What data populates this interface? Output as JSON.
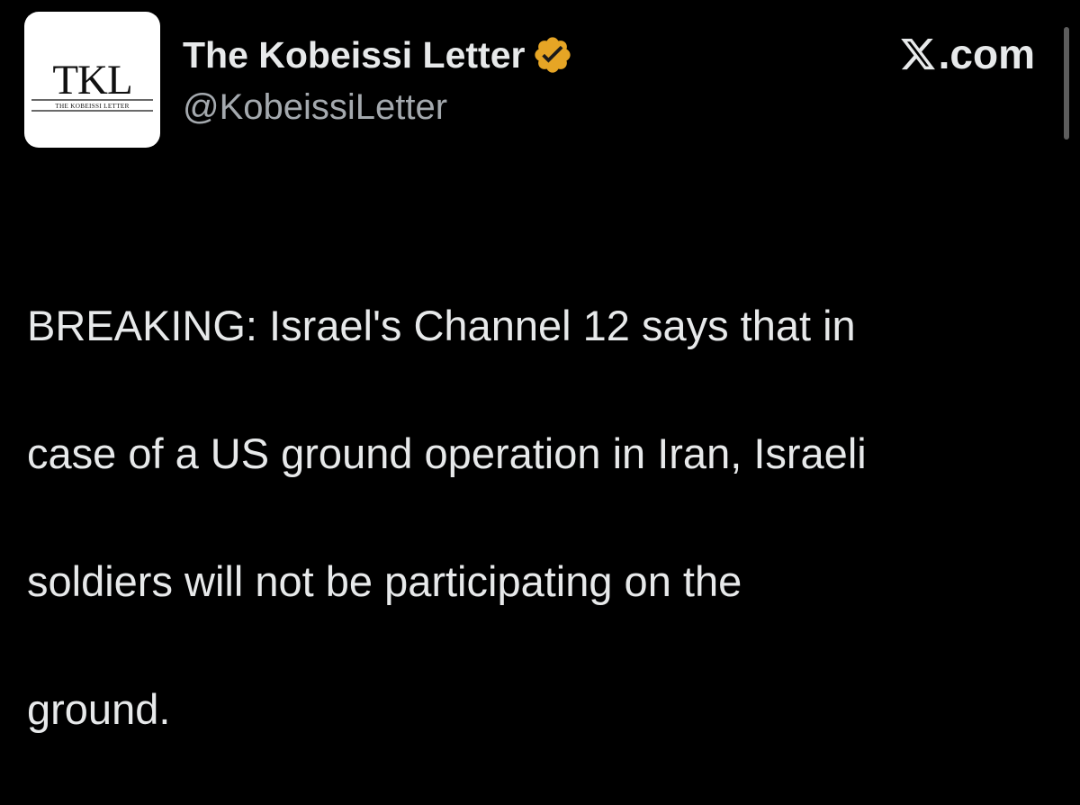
{
  "post": {
    "author": {
      "display_name": "The Kobeissi Letter",
      "handle": "@KobeissiLetter",
      "avatar": {
        "monogram": "TKL",
        "wordmark": "THE KOBEISSI LETTER"
      },
      "verified": true,
      "verified_badge_color": "#e6a525"
    },
    "source": {
      "label": ".com",
      "icon": "x-logo-icon"
    },
    "text_lines": [
      "BREAKING: Israel's Channel 12 says that in",
      "case of a US ground operation in Iran, Israeli",
      "soldiers will not be participating on the",
      "ground."
    ]
  },
  "colors": {
    "background": "#000000",
    "primary_text": "#e7e9ea",
    "secondary_text": "#a4a9ae",
    "badge_gold": "#e6a525"
  }
}
